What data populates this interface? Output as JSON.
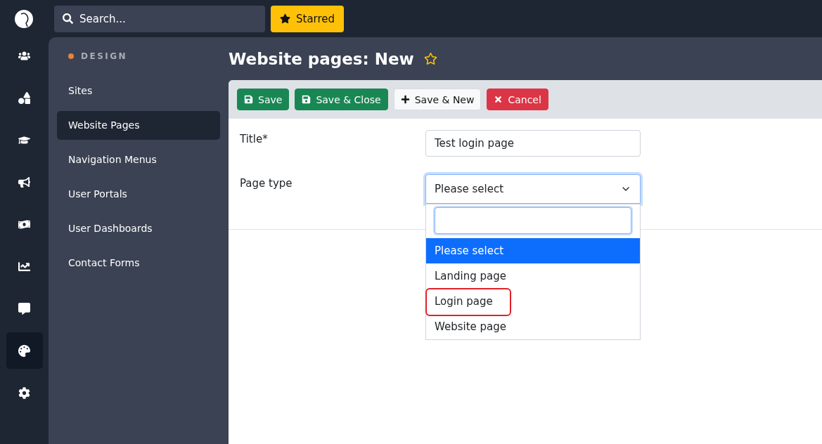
{
  "topbar": {
    "search": {
      "placeholder": "Search..."
    },
    "starred_button": "Starred"
  },
  "rail": [
    {
      "kind": "users",
      "selected": false
    },
    {
      "kind": "shapes",
      "selected": false
    },
    {
      "kind": "education",
      "selected": false
    },
    {
      "kind": "marketing",
      "selected": false
    },
    {
      "kind": "money",
      "selected": false
    },
    {
      "kind": "analytics",
      "selected": false
    },
    {
      "kind": "messages",
      "selected": false
    },
    {
      "kind": "design",
      "selected": true
    },
    {
      "kind": "settings",
      "selected": false
    }
  ],
  "sidebar": {
    "section": "DESIGN",
    "items": [
      {
        "label": "Sites",
        "selected": false
      },
      {
        "label": "Website Pages",
        "selected": true
      },
      {
        "label": "Navigation Menus",
        "selected": false
      },
      {
        "label": "User Portals",
        "selected": false
      },
      {
        "label": "User Dashboards",
        "selected": false
      },
      {
        "label": "Contact Forms",
        "selected": false
      }
    ]
  },
  "page": {
    "title": "Website pages: New",
    "starred": false
  },
  "toolbar": [
    {
      "kind": "save",
      "label": "Save"
    },
    {
      "kind": "save",
      "label": "Save & Close"
    },
    {
      "kind": "new",
      "label": "Save & New"
    },
    {
      "kind": "cancel",
      "label": "Cancel"
    }
  ],
  "form": {
    "fields": [
      {
        "kind": "text",
        "label": "Title*",
        "value": "Test login page"
      },
      {
        "kind": "select",
        "label": "Page type",
        "value": "Please select",
        "expanded": true,
        "options": [
          {
            "label": "Please select",
            "selected": true,
            "highlighted": false
          },
          {
            "label": "Landing page",
            "selected": false,
            "highlighted": false
          },
          {
            "label": "Login page",
            "selected": false,
            "highlighted": true
          },
          {
            "label": "Website page",
            "selected": false,
            "highlighted": false
          }
        ]
      }
    ]
  }
}
